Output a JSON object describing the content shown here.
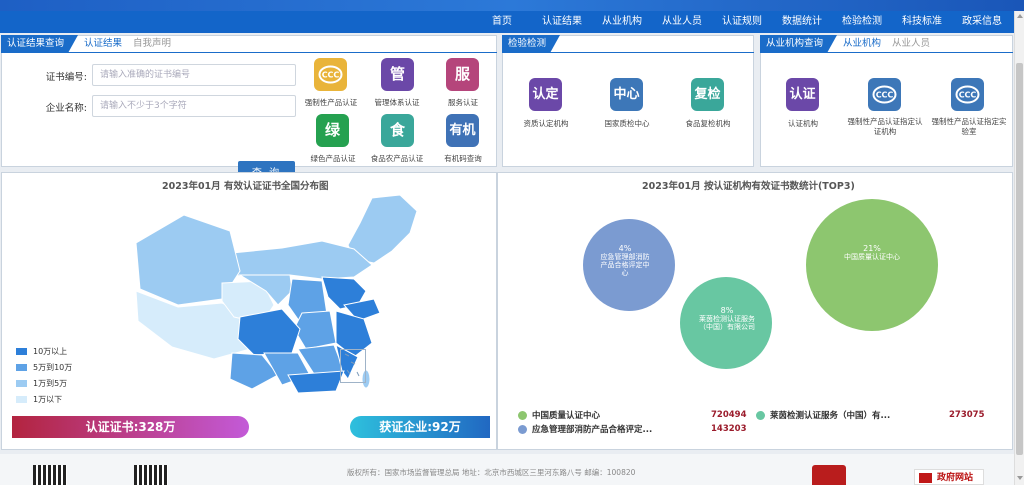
{
  "nav": {
    "items": [
      "首页",
      "认证结果",
      "从业机构",
      "从业人员",
      "认证规则",
      "数据统计",
      "检验检测",
      "科技标准",
      "政采信息"
    ]
  },
  "cert_query": {
    "tab_active": "认证结果查询",
    "tab_links": [
      "认证结果",
      "自我声明"
    ],
    "cert_no_label": "证书编号:",
    "cert_no_placeholder": "请输入准确的证书编号",
    "company_label": "企业名称:",
    "company_placeholder": "请输入不少于3个字符",
    "query_button": "查 询",
    "tiles": [
      {
        "glyph": "CCC",
        "label": "强制性产品认证",
        "color": "#e9b43a"
      },
      {
        "glyph": "管",
        "label": "管理体系认证",
        "color": "#6b48a8"
      },
      {
        "glyph": "服",
        "label": "服务认证",
        "color": "#b5457b"
      },
      {
        "glyph": "绿",
        "label": "绿色产品认证",
        "color": "#25a150"
      },
      {
        "glyph": "食",
        "label": "食品农产品认证",
        "color": "#3aa79a"
      },
      {
        "glyph": "有机",
        "label": "有机码查询",
        "color": "#3f72b6"
      }
    ]
  },
  "inspection": {
    "tab_active": "检验检测",
    "tiles": [
      {
        "glyph": "认定",
        "label": "资质认定机构",
        "color": "#6b48a8"
      },
      {
        "glyph": "中心",
        "label": "国家质检中心",
        "color": "#3d77b8"
      },
      {
        "glyph": "复检",
        "label": "食品复检机构",
        "color": "#3aa79a"
      }
    ]
  },
  "agency_query": {
    "tab_active": "从业机构查询",
    "tab_links": [
      "从业机构",
      "从业人员"
    ],
    "tiles": [
      {
        "glyph": "认证",
        "label": "认证机构",
        "color": "#6b48a8"
      },
      {
        "glyph": "CCC",
        "label": "强制性产品认证指定认证机构",
        "color": "#3d77b8"
      },
      {
        "glyph": "CCC",
        "label": "强制性产品认证指定实验室",
        "color": "#3d77b8"
      }
    ]
  },
  "map_chart": {
    "title": "2023年01月 有效认证证书全国分布图",
    "legend": [
      {
        "label": "10万以上",
        "color": "#2d7fd9"
      },
      {
        "label": "5万到10万",
        "color": "#5ea2e6"
      },
      {
        "label": "1万到5万",
        "color": "#9ccbf2"
      },
      {
        "label": "1万以下",
        "color": "#d6ecfb"
      }
    ],
    "cert_total": "认证证书:328万",
    "company_total": "获证企业:92万"
  },
  "chart_data": {
    "type": "bubble",
    "title": "2023年01月 按认证机构有效证书数统计(TOP3)",
    "series": [
      {
        "name": "中国质量认证中心",
        "value": 720494,
        "percent": "21%",
        "color": "#8dc66f"
      },
      {
        "name": "莱茵检测认证服务（中国）有...",
        "bubble_label": "莱茵检测认证服务（中国）有限公司",
        "value": 273075,
        "percent": "8%",
        "color": "#68c7a2"
      },
      {
        "name": "应急管理部消防产品合格评定...",
        "bubble_label": "应急管理部消防产品合格评定中心",
        "value": 143203,
        "percent": "4%",
        "color": "#7b9bd1"
      }
    ]
  },
  "footer": {
    "text": "版权所有：国家市场监督管理总局    地址：北京市西城区三里河东路八号    邮编：100820",
    "gov_site": "政府网站"
  }
}
